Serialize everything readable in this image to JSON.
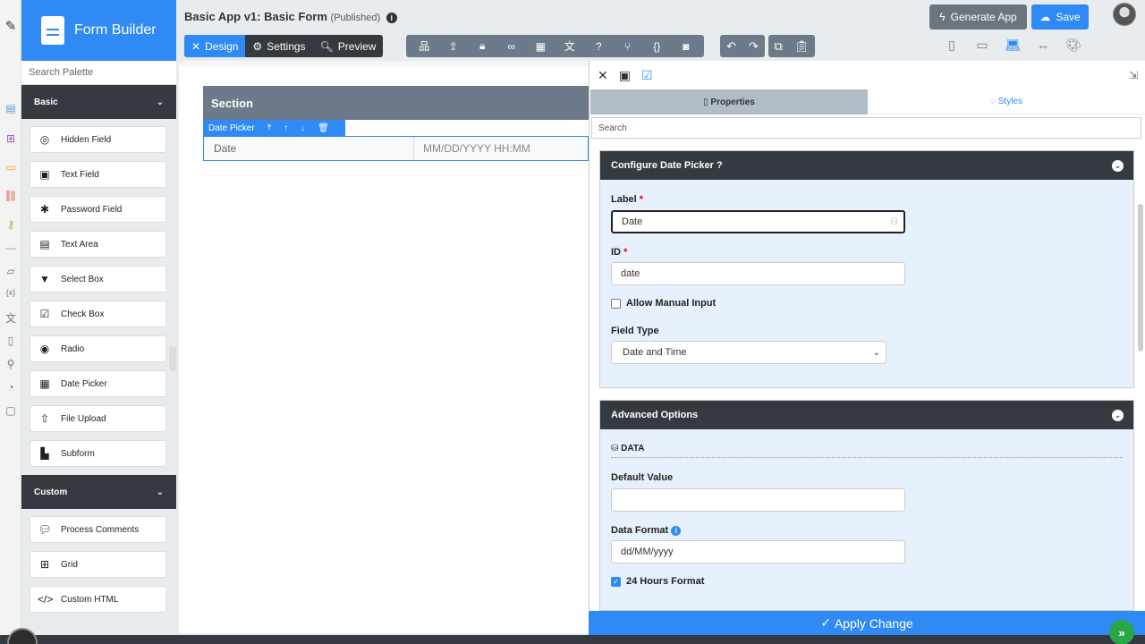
{
  "brand": {
    "title": "Form Builder"
  },
  "header": {
    "app_title": "Basic App v1: Basic Form",
    "status": "(Published)",
    "tabs": [
      {
        "label": "Design"
      },
      {
        "label": "Settings"
      },
      {
        "label": "Preview"
      }
    ],
    "generate_label": "Generate App",
    "save_label": "Save"
  },
  "palette": {
    "search_placeholder": "Search Palette",
    "groups": [
      {
        "title": "Basic",
        "items": [
          {
            "label": "Hidden Field",
            "icon": "eye-slash-icon"
          },
          {
            "label": "Text Field",
            "icon": "text-field-icon"
          },
          {
            "label": "Password Field",
            "icon": "asterisk-icon"
          },
          {
            "label": "Text Area",
            "icon": "text-area-icon"
          },
          {
            "label": "Select Box",
            "icon": "select-box-icon"
          },
          {
            "label": "Check Box",
            "icon": "check-box-icon"
          },
          {
            "label": "Radio",
            "icon": "radio-icon"
          },
          {
            "label": "Date Picker",
            "icon": "calendar-icon"
          },
          {
            "label": "File Upload",
            "icon": "upload-icon"
          },
          {
            "label": "Subform",
            "icon": "subform-icon"
          }
        ]
      },
      {
        "title": "Custom",
        "items": [
          {
            "label": "Process Comments",
            "icon": "comments-icon"
          },
          {
            "label": "Grid",
            "icon": "grid-icon"
          },
          {
            "label": "Custom HTML",
            "icon": "code-icon"
          }
        ]
      }
    ]
  },
  "canvas": {
    "section_title": "Section",
    "component_toolbar_label": "Date Picker",
    "field_label": "Date",
    "field_placeholder": "MM/DD/YYYY HH:MM"
  },
  "properties": {
    "tab_properties": "Properties",
    "tab_styles": "Styles",
    "search_placeholder": "Search",
    "configure": {
      "title": "Configure Date Picker",
      "label_label": "Label",
      "label_value": "Date",
      "id_label": "ID",
      "id_value": "date",
      "allow_manual_input": "Allow Manual Input",
      "field_type_label": "Field Type",
      "field_type_value": "Date and Time"
    },
    "advanced": {
      "title": "Advanced Options",
      "data_section": "DATA",
      "default_value_label": "Default Value",
      "default_value": "",
      "data_format_label": "Data Format",
      "data_format_value": "dd/MM/yyyy",
      "hours_24_label": "24 Hours Format"
    },
    "apply_label": "Apply Change"
  },
  "colors": {
    "accent": "#2f8af5",
    "dark": "#343a40",
    "toolbar": "#6c7a89",
    "success": "#28a745"
  }
}
